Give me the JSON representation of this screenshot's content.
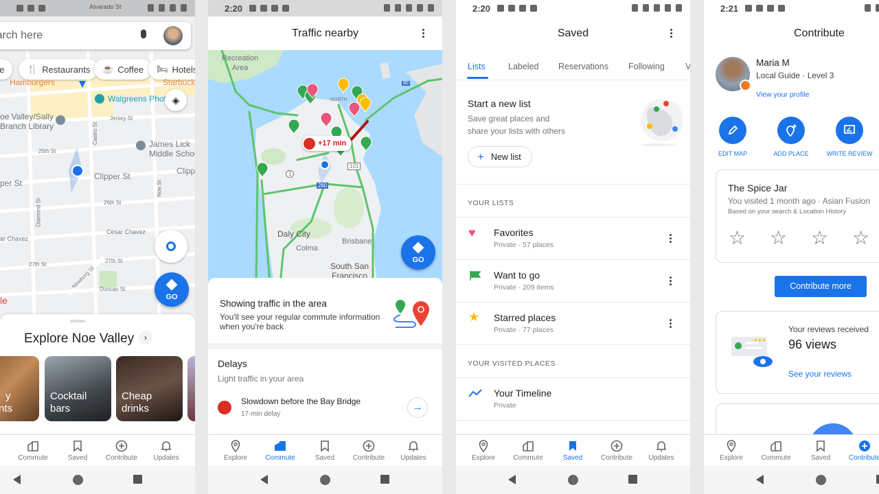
{
  "explore": {
    "search_placeholder": "Search here",
    "chips": [
      "ne",
      "Restaurants",
      "Coffee",
      "Hotels"
    ],
    "map_labels": {
      "hamburgers": "Hamburgers",
      "starbucks": "Starbuck",
      "walgreens": "Walgreens Phot",
      "library": "oe Valley/Sally",
      "library2": "Branch Library",
      "school": "James Lick",
      "school2": "Middle Schoo",
      "clipper": "Clipper St",
      "clipper_left": "per St",
      "clipper_right": "Clipp",
      "s25": "25th St",
      "s26": "26th St",
      "cesar": "Cesar Chavez",
      "cesar_left": "ar Chavez",
      "s27": "27th St",
      "s27b": "27th St",
      "castro": "Castro St",
      "diamond": "Diamond St",
      "noe": "Noe St",
      "jersey": "Jersey St",
      "newburg": "Newburg St",
      "duncan": "Duncan St",
      "alvarado": "Alvarado St",
      "google": "le"
    },
    "go_label": "GO",
    "sheet_title": "Explore Noe Valley",
    "cards": [
      {
        "line1": "y",
        "line2": "aurants"
      },
      {
        "line1": "Cocktail",
        "line2": "bars"
      },
      {
        "line1": "Cheap",
        "line2": "drinks"
      }
    ],
    "nav": [
      "Commute",
      "Saved",
      "Contribute",
      "Updates"
    ]
  },
  "commute": {
    "time": "2:20",
    "title": "Traffic nearby",
    "map_labels": {
      "recreation": "Recreation",
      "area": "Area",
      "daly": "Daly City",
      "colma": "Colma",
      "brisbane": "Brisbane",
      "ssf": "South San",
      "ssf2": "Francisco",
      "north": "NORTH"
    },
    "shields": {
      "s101": "101",
      "s280": "280",
      "s1": "1",
      "s80": "80"
    },
    "delay_badge": "+17 min",
    "go_label": "GO",
    "info_title": "Showing traffic in the area",
    "info_text1": "You'll see your regular commute information",
    "info_text2": "when you're back",
    "delays_title": "Delays",
    "delays_sub": "Light traffic in your area",
    "delay_item": "Slowdown before the Bay Bridge",
    "delay_item_sub": "17-min delay",
    "nav": [
      "Explore",
      "Commute",
      "Saved",
      "Contribute",
      "Updates"
    ],
    "active_nav": "Commute"
  },
  "saved": {
    "time": "2:20",
    "title": "Saved",
    "tabs": [
      "Lists",
      "Labeled",
      "Reservations",
      "Following",
      "V"
    ],
    "active_tab": "Lists",
    "new_list_title": "Start a new list",
    "new_list_text1": "Save great places and",
    "new_list_text2": "share your lists with others",
    "new_list_button": "New list",
    "your_lists": "YOUR LISTS",
    "lists": [
      {
        "name": "Favorites",
        "meta": "Private · 57 places",
        "icon": "heart-icon",
        "color": "#e8567c"
      },
      {
        "name": "Want to go",
        "meta": "Private · 209 items",
        "icon": "flag-icon",
        "color": "#34a853"
      },
      {
        "name": "Starred places",
        "meta": "Private · 77 places",
        "icon": "star-icon",
        "color": "#fbbc04"
      }
    ],
    "visited": "YOUR VISITED PLACES",
    "timeline": {
      "name": "Your Timeline",
      "meta": "Private"
    },
    "nav": [
      "Explore",
      "Commute",
      "Saved",
      "Contribute",
      "Updates"
    ],
    "active_nav": "Saved"
  },
  "contribute": {
    "time": "2:21",
    "title": "Contribute",
    "user_name": "Maria M",
    "user_level": "Local Guide · Level 3",
    "profile_link": "View your profile",
    "actions": [
      "EDIT MAP",
      "ADD PLACE",
      "WRITE REVIEW"
    ],
    "place_name": "The Spice Jar",
    "place_meta": "You visited 1 month ago · Asian Fusion",
    "place_basis": "Based on your search & Location History",
    "rating": 0,
    "contribute_more": "Contribute more",
    "reviews_label": "Your reviews received",
    "reviews_views": "96 views",
    "reviews_link": "See your reviews",
    "nav": [
      "Explore",
      "Commute",
      "Saved",
      "Contribute"
    ],
    "active_nav": "Contribute"
  },
  "colors": {
    "accent": "#1a73e8",
    "traffic_green": "#5cc46a",
    "traffic_red": "#d93025",
    "water": "#aadaff"
  }
}
